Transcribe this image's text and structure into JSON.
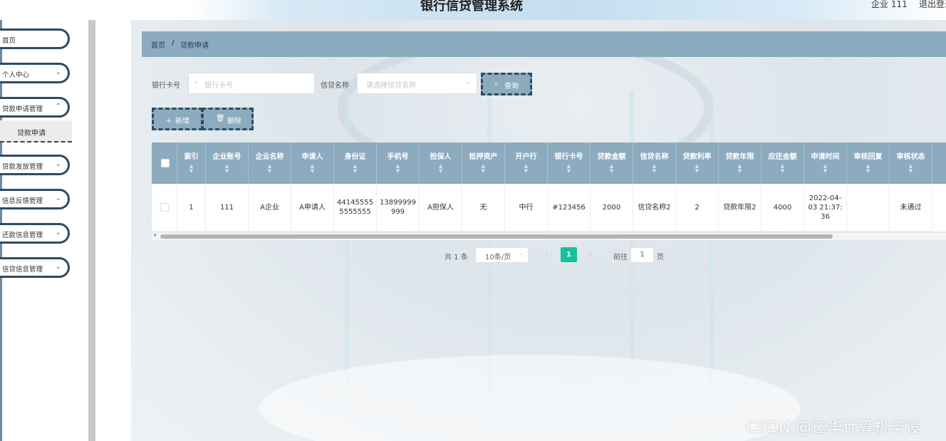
{
  "header": {
    "title": "银行信贷管理系统",
    "user": "企业 111",
    "logout": "退出登录"
  },
  "sidebar": {
    "items": [
      {
        "label": "首页",
        "has_chevron": false
      },
      {
        "label": "个人中心",
        "has_chevron": true
      },
      {
        "label": "贷款申请管理",
        "has_chevron": true
      },
      {
        "label": "贷款发放管理",
        "has_chevron": true
      },
      {
        "label": "信息反馈管理",
        "has_chevron": true
      },
      {
        "label": "还款信息管理",
        "has_chevron": true
      },
      {
        "label": "信贷信息管理",
        "has_chevron": true
      }
    ],
    "submenu": {
      "label": "贷款申请"
    }
  },
  "breadcrumb": {
    "home": "首页",
    "separator": "/",
    "current": "贷款申请"
  },
  "search": {
    "card_label": "银行卡号",
    "card_placeholder": "银行卡号",
    "credit_label": "信贷名称",
    "credit_placeholder": "请选择信贷名称",
    "query_button": "查询"
  },
  "actions": {
    "add": "新增",
    "delete": "删除"
  },
  "table": {
    "columns": [
      "索引",
      "企业账号",
      "企业名称",
      "申请人",
      "身份证",
      "手机号",
      "担保人",
      "抵押资产",
      "开户行",
      "银行卡号",
      "贷款金额",
      "信贷名称",
      "贷款利率",
      "贷款年限",
      "应还金额",
      "申请时间",
      "审核回复",
      "审核状态"
    ],
    "rows": [
      [
        "1",
        "111",
        "A企业",
        "A申请人",
        "441455555555555",
        "13899999999",
        "A担保人",
        "无",
        "中行",
        "#123456",
        "2000",
        "信贷名称2",
        "2",
        "贷款年限2",
        "4000",
        "2022-04-03 21:37:36",
        "",
        "未通过"
      ]
    ]
  },
  "pagination": {
    "total": "共 1 条",
    "page_size": "10条/页",
    "prev": "‹",
    "current_page": "1",
    "next": "›",
    "goto_label": "前往",
    "goto_value": "1",
    "goto_suffix": "页"
  },
  "watermark": "CSDN @达华计算机毕设",
  "colors": {
    "accent": "#8cabbf",
    "border_dark": "#2f4a63",
    "page_active": "#13c39a"
  }
}
